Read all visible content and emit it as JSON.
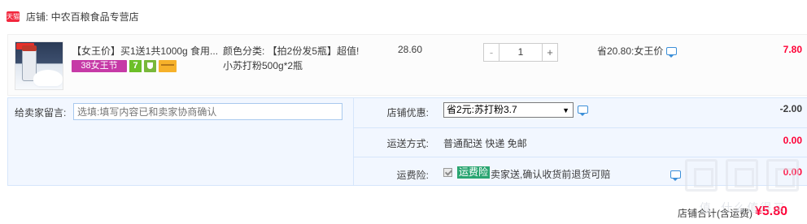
{
  "shop": {
    "badge": "天猫",
    "label": "店铺: 中农百粮食品专营店"
  },
  "item": {
    "title": "【女王价】买1送1共1000g 食用...",
    "tags": [
      "38女王节",
      "7"
    ],
    "sku": "颜色分类: 【拍2份发5瓶】超值! 小苏打粉500g*2瓶",
    "unit_price": "28.60",
    "quantity": "1",
    "qty_minus": "-",
    "qty_plus": "+",
    "saving": "省20.80:女王价",
    "total": "7.80"
  },
  "memo": {
    "label": "给卖家留言:",
    "placeholder": "选填:填写内容已和卖家协商确认"
  },
  "promo": {
    "label": "店铺优惠:",
    "selected": "省2元:苏打粉3.7",
    "amount": "-2.00"
  },
  "shipping": {
    "label": "运送方式:",
    "method": "普通配送 快递 免邮",
    "amount": "0.00"
  },
  "insurance": {
    "label": "运费险:",
    "badge": "运费险",
    "text": "卖家送,确认收货前退货可赔",
    "amount": "0.00"
  },
  "summary": {
    "label": "店铺合计(含运费)",
    "amount": "¥5.80"
  },
  "colors": {
    "accent_red": "#ff0036",
    "tmall_red": "#f2273d",
    "panel_blue": "#f2f7ff",
    "border_blue": "#d6e6fb",
    "insurance_green": "#2aa571"
  },
  "watermark": {
    "text": "值 什么值得买"
  }
}
